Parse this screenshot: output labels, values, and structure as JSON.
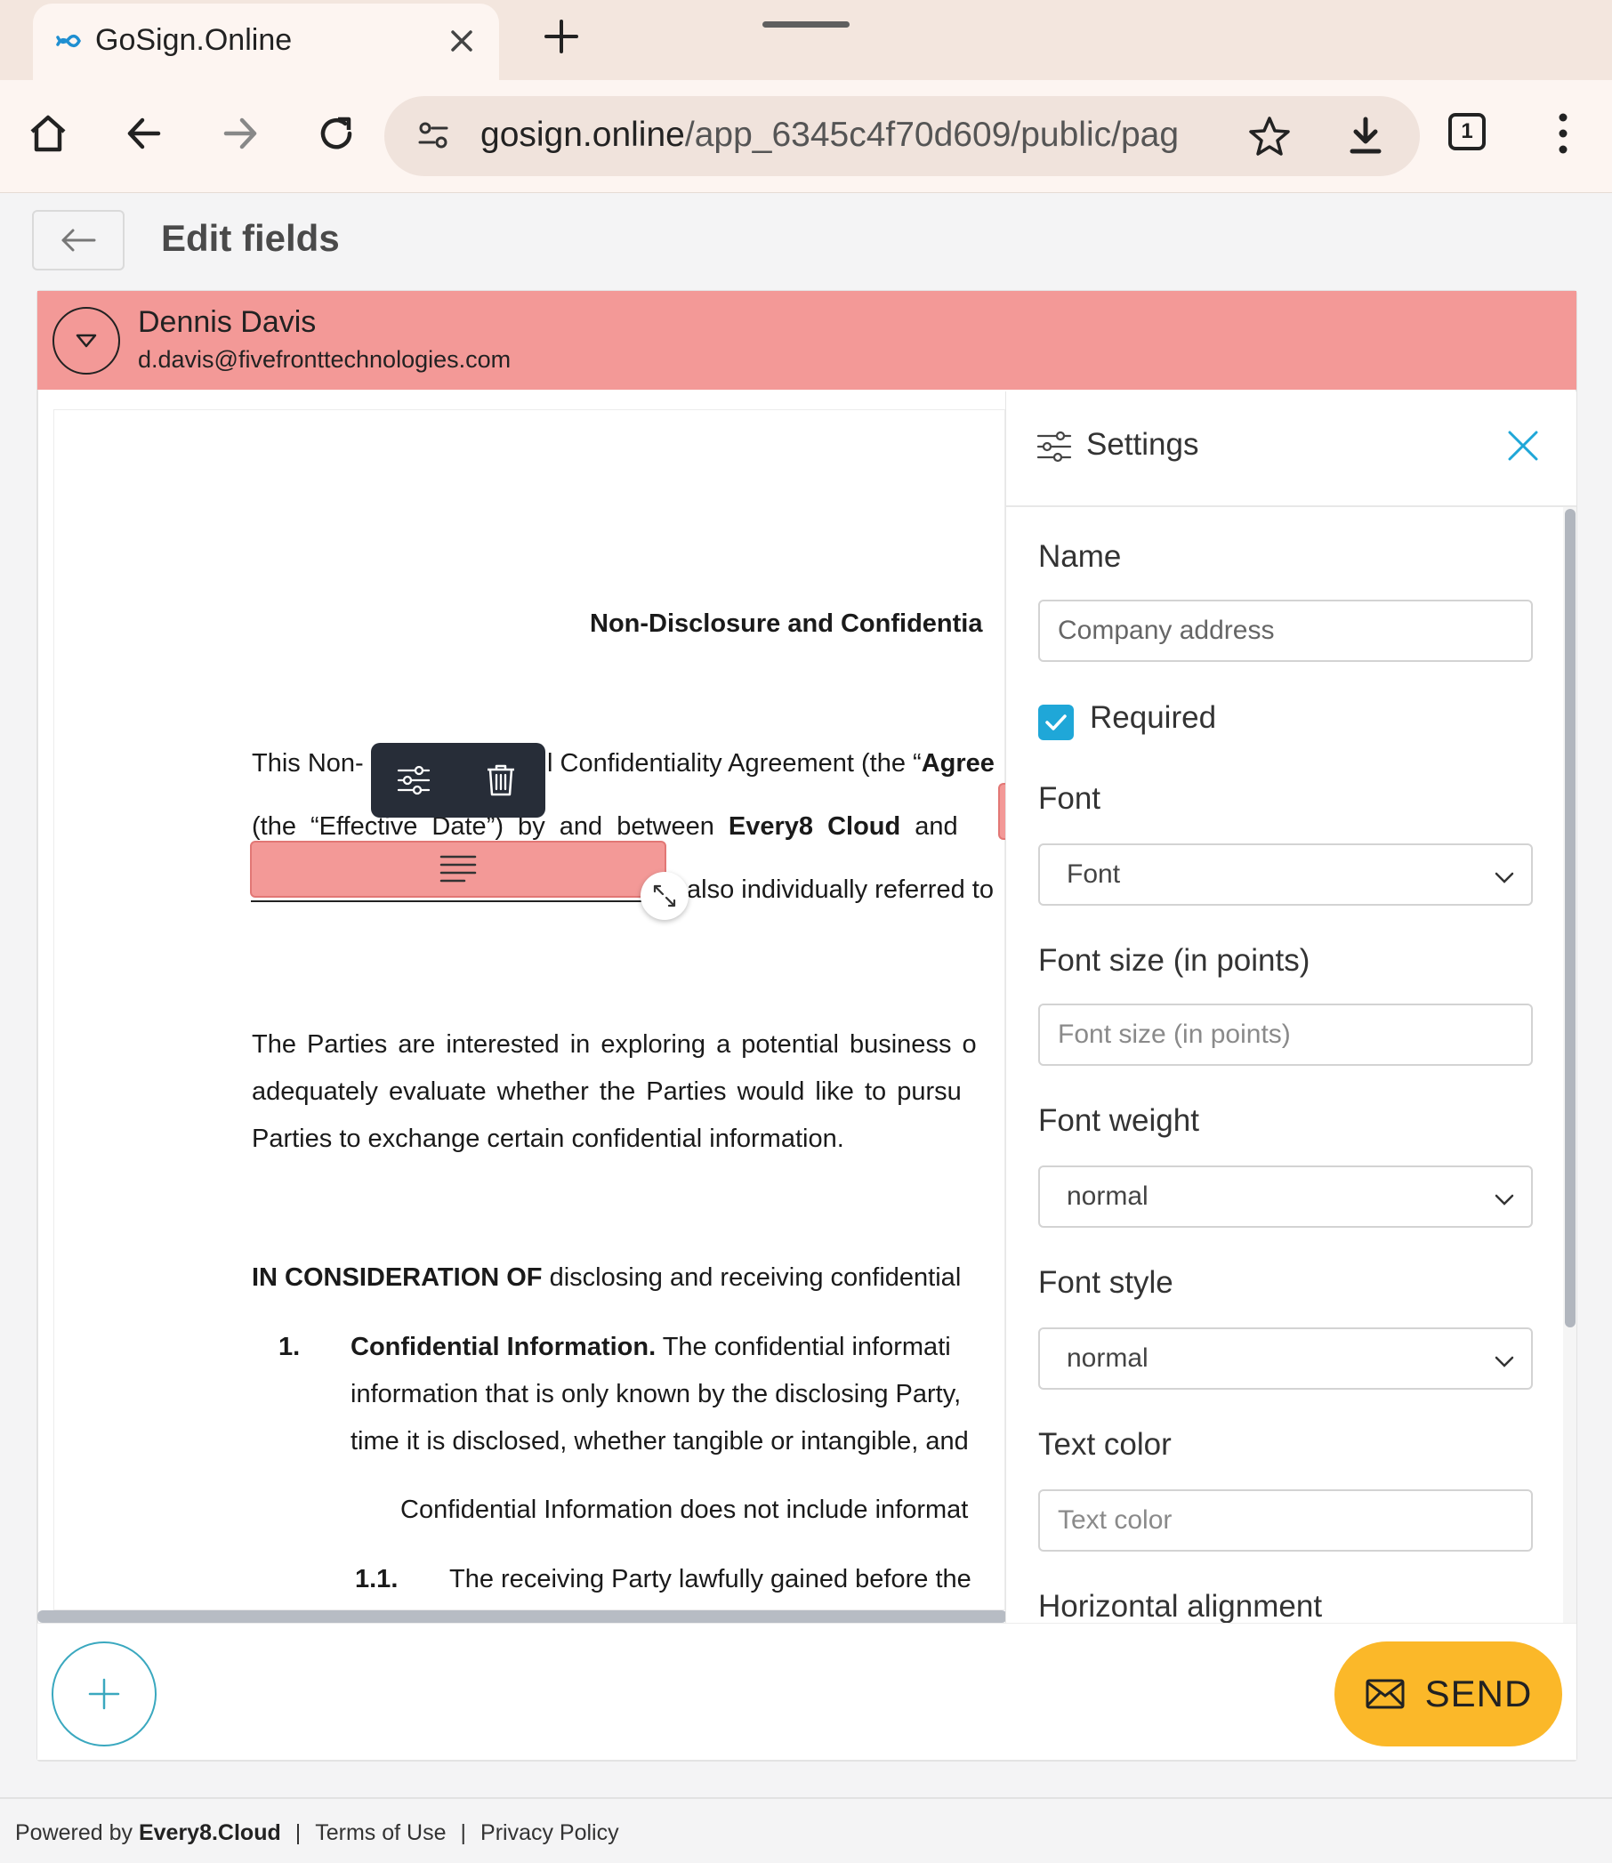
{
  "browser": {
    "tab_title": "GoSign.Online",
    "url_domain": "gosign.online",
    "url_path": "/app_6345c4f70d609/public/pag",
    "tab_count": "1"
  },
  "header": {
    "title": "Edit fields"
  },
  "signer": {
    "name": "Dennis Davis",
    "email": "d.davis@fivefronttechnologies.com",
    "color": "#f39997"
  },
  "document": {
    "heading": "Non-Disclosure and Confidentia",
    "p1_line1_a": "This Non-",
    "p1_line1_b": "l Confidentiality Agreement (the “",
    "p1_line1_c": "Agree",
    "p1_line2_a": "(the “Effective Date”) by and between ",
    "p1_line2_b": "Every8 Cloud",
    "p1_line2_c": " and",
    "p1_line3": "also individually referred to",
    "p2_line1": "The Parties are interested in exploring a potential business o",
    "p2_line2": "adequately evaluate whether the Parties would like to pursu",
    "p2_line3": "Parties to exchange certain confidential information.",
    "p3_bold": "IN CONSIDERATION OF",
    "p3_rest": " disclosing and receiving confidential",
    "item1_num": "1.",
    "item1_bold": "Confidential Information.",
    "item1_rest": " The confidential informati",
    "item1_line2": "information that is only known by the disclosing Party,",
    "item1_line3": "time it is disclosed, whether tangible or intangible, and",
    "item1_line4": "Confidential Information does not include informat",
    "item11_num": "1.1.",
    "item11_text": "The receiving Party lawfully gained before the"
  },
  "settings": {
    "title": "Settings",
    "name_label": "Name",
    "name_value": "Company address",
    "required_label": "Required",
    "required_checked": true,
    "font_label": "Font",
    "font_value": "Font",
    "font_size_label": "Font size (in points)",
    "font_size_placeholder": "Font size (in points)",
    "font_weight_label": "Font weight",
    "font_weight_value": "normal",
    "font_style_label": "Font style",
    "font_style_value": "normal",
    "text_color_label": "Text color",
    "text_color_placeholder": "Text color",
    "h_align_label": "Horizontal alignment",
    "accent_color": "#1fa7d8"
  },
  "actions": {
    "send_label": "SEND",
    "send_color": "#fbb829"
  },
  "footer": {
    "powered_prefix": "Powered by ",
    "powered_brand": "Every8.Cloud",
    "terms": "Terms of Use",
    "privacy": "Privacy Policy",
    "separator": "|"
  }
}
